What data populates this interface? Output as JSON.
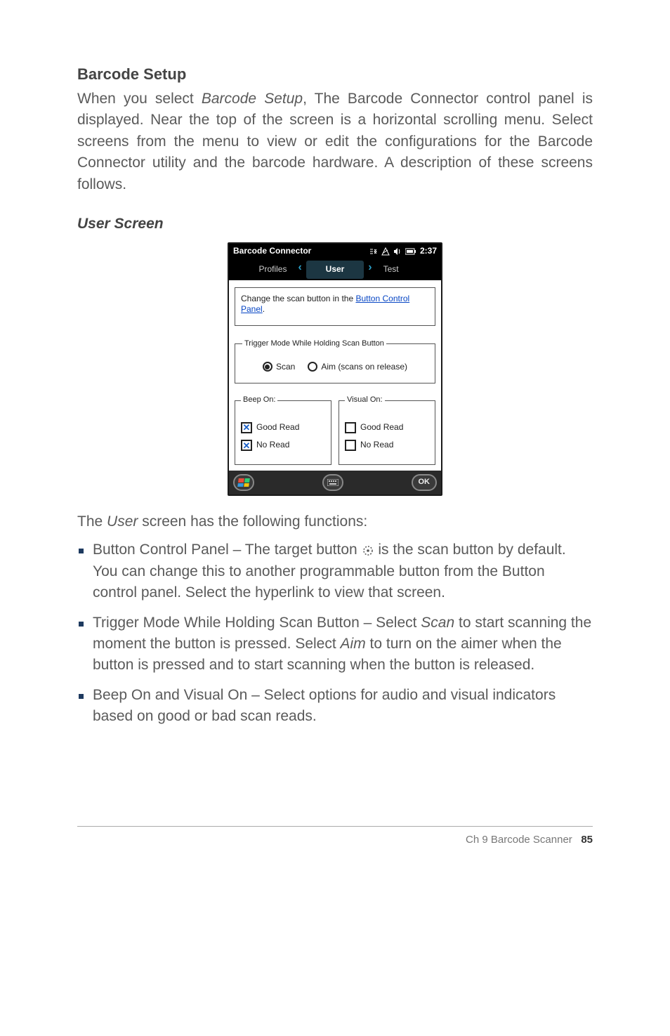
{
  "heading": "Barcode Setup",
  "intro": "When you select Barcode Setup, The Barcode Connector control panel is displayed. Near the top of the screen is a horizontal scrolling menu. Select screens from the menu to view or edit the configurations for the Barcode Connector utility and the barcode hardware. A description of these screens follows.",
  "intro_italic_phrase": "Barcode Setup",
  "subheading": "User Screen",
  "device": {
    "app_title": "Barcode Connector",
    "clock": "2:37",
    "nav": {
      "left": "Profiles",
      "center": "User",
      "right": "Test"
    },
    "info_text_prefix": "Change the scan button in the ",
    "info_link": "Button Control Panel",
    "info_text_suffix": ".",
    "trigger_legend": "Trigger Mode While Holding Scan Button",
    "radio_scan": "Scan",
    "radio_aim": "Aim (scans on release)",
    "beep_legend": "Beep On:",
    "visual_legend": "Visual On:",
    "cb_good_read": "Good Read",
    "cb_no_read": "No Read",
    "ok": "OK"
  },
  "follow_text_prefix": "The ",
  "follow_italic": "User",
  "follow_text_suffix": " screen has the following functions:",
  "bullets": {
    "b1_prefix": "Button Control Panel – The target button ",
    "b1_suffix": " is the scan button by default. You can change this to another programmable button from the Button control panel. Select the hyperlink to view that screen.",
    "b2_prefix": "Trigger Mode While Holding Scan Button – Select ",
    "b2_scan": "Scan",
    "b2_mid": " to start scanning the moment the button is pressed. Select ",
    "b2_aim": "Aim",
    "b2_suffix": " to turn on the aimer when the button is pressed and to start scanning when the button is released.",
    "b3": "Beep On and Visual On – Select options for audio and visual indicators based on good or bad scan reads."
  },
  "footer": {
    "chapter": "Ch 9   Barcode Scanner",
    "page": "85"
  }
}
